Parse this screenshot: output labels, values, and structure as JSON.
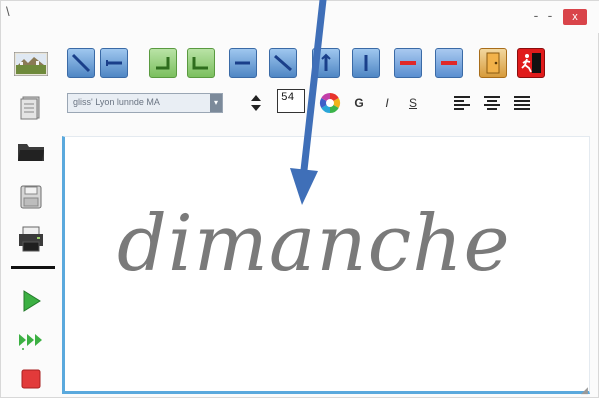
{
  "window": {
    "title_glyph": "\\",
    "minimize_glyph": "-",
    "maximize_glyph": "-",
    "close_glyph": "x"
  },
  "format": {
    "font_name": "gliss' Lyon lunnde MA",
    "font_size": "54",
    "bold_glyph": "G",
    "italic_glyph": "I",
    "underline_glyph": "S"
  },
  "canvas": {
    "text": "dimanche"
  },
  "colors": {
    "accent_blue": "#3f6fb8",
    "canvas_border": "#5aa9dd",
    "handwriting": "#7a7a7a",
    "close_red": "#d9444a"
  }
}
